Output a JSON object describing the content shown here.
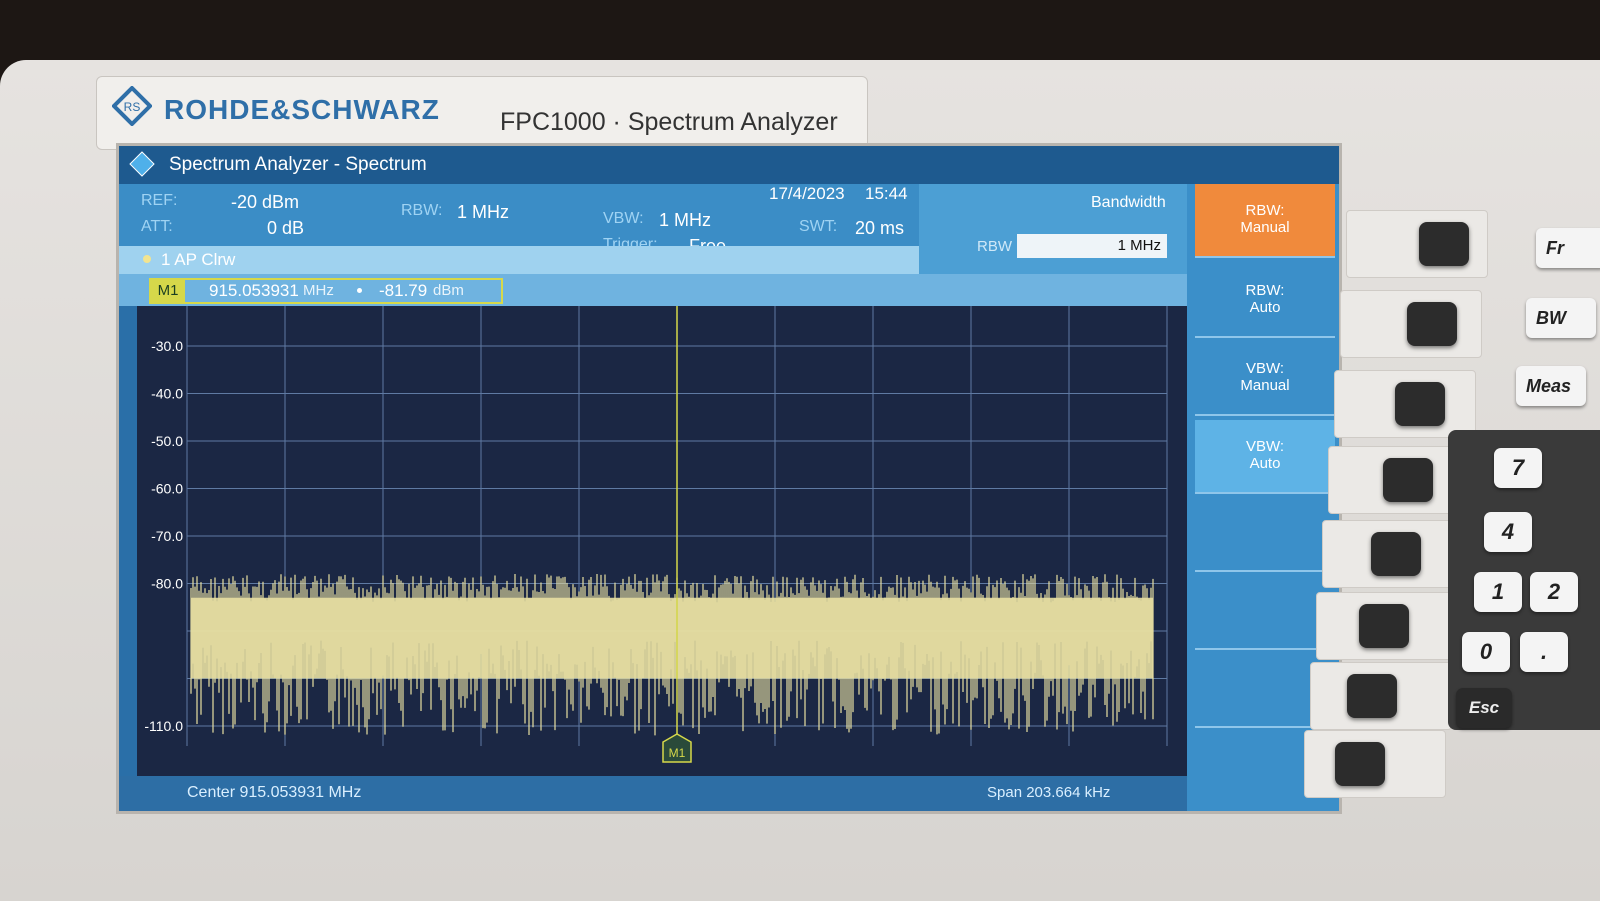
{
  "brand": {
    "name": "ROHDE&SCHWARZ",
    "model": "FPC1000 · Spectrum Analyzer"
  },
  "title": "Spectrum Analyzer - Spectrum",
  "settings": {
    "ref_label": "REF:",
    "ref_value": "-20 dBm",
    "att_label": "ATT:",
    "att_value": "0 dB",
    "rbw_label": "RBW:",
    "rbw_value": "1 MHz",
    "vbw_label": "VBW:",
    "vbw_value": "1 MHz",
    "trigger_label": "Trigger:",
    "trigger_value": "Free",
    "swt_label": "SWT:",
    "swt_value": "20 ms",
    "date": "17/4/2023",
    "time": "15:44"
  },
  "trace_label": "1 AP  Clrw",
  "marker": {
    "tag": "M1",
    "frequency": "915.053931",
    "freq_unit": "MHz",
    "level": "-81.79",
    "level_unit": "dBm",
    "plot_label": "M1"
  },
  "plot": {
    "y_labels": [
      "-30.0",
      "-40.0",
      "-50.0",
      "-60.0",
      "-70.0",
      "-80.0",
      "-110.0"
    ],
    "y_values": [
      -30,
      -40,
      -50,
      -60,
      -70,
      -80,
      -110
    ],
    "grid_cols": 10,
    "trace_color": "#e8e0a2",
    "noise_top_dbm": -80,
    "noise_floor_dbm": -110,
    "marker_fraction": 0.5
  },
  "footer": {
    "center": "Center 915.053931 MHz",
    "span": "Span 203.664 kHz"
  },
  "bandwidth_panel": {
    "title": "Bandwidth",
    "rbw_label": "RBW",
    "rbw_input": "1 MHz"
  },
  "softkeys": [
    {
      "line1": "RBW:",
      "line2": "Manual",
      "active": true
    },
    {
      "line1": "RBW:",
      "line2": "Auto",
      "active": false
    },
    {
      "line1": "VBW:",
      "line2": "Manual",
      "active": false
    },
    {
      "line1": "VBW:",
      "line2": "Auto",
      "active": false
    }
  ],
  "keypad": {
    "k7": "7",
    "k4": "4",
    "k1": "1",
    "k2": "2",
    "k0": "0",
    "kdot": ".",
    "esc": "Esc"
  },
  "side_keys": {
    "freq": "Fr",
    "bw": "BW",
    "meas": "Meas"
  },
  "colors": {
    "accent_orange": "#f08a3c",
    "screen_blue": "#2a6fa8",
    "plot_bg": "#1b2744",
    "marker_yellow": "#d6d84a"
  }
}
